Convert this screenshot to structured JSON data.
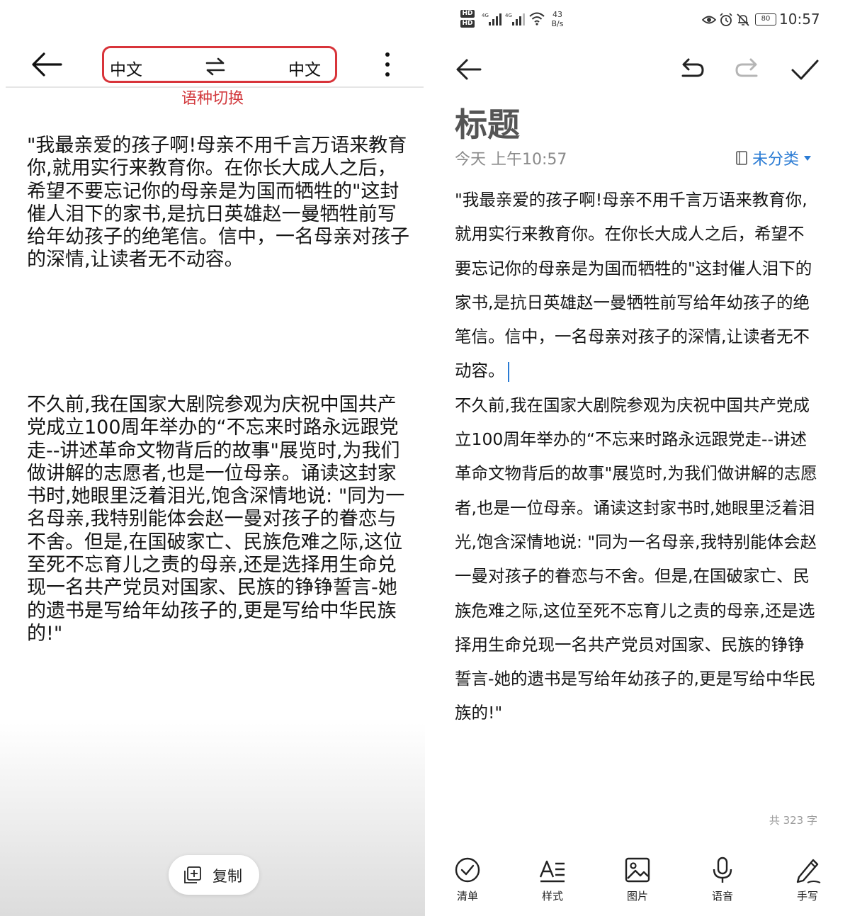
{
  "left": {
    "lang_source": "中文",
    "lang_target": "中文",
    "switch_caption": "语种切换",
    "paragraph_1": "\"我最亲爱的孩子啊!母亲不用千言万语来教育你,就用实行来教育你。在你长大成人之后，希望不要忘记你的母亲是为国而牺牲的\"这封催人泪下的家书,是抗日英雄赵一曼牺牲前写给年幼孩子的绝笔信。信中，一名母亲对孩子的深情,让读者无不动容。",
    "paragraph_2": "不久前,我在国家大剧院参观为庆祝中国共产党成立100周年举办的“不忘来时路永远跟党走--讲述革命文物背后的故事\"展览时,为我们做讲解的志愿者,也是一位母亲。诵读这封家书时,她眼里泛着泪光,饱含深情地说: \"同为一名母亲,我特别能体会赵一曼对孩子的眷恋与不舍。但是,在国破家亡、民族危难之际,这位至死不忘育儿之责的母亲,还是选择用生命兑现一名共产党员对国家、民族的铮铮誓言-她的遗书是写给年幼孩子的,更是写给中华民族的!\"",
    "copy_label": "复制"
  },
  "status_bar": {
    "badge_1": "HD",
    "badge_2": "HD",
    "speed_value": "43",
    "speed_unit": "B/s",
    "battery": "80",
    "time": "10:57"
  },
  "note": {
    "title": "标题",
    "date": "今天 上午10:57",
    "category": "未分类",
    "body_1": "\"我最亲爱的孩子啊!母亲不用千言万语来教育你,就用实行来教育你。在你长大成人之后，希望不要忘记你的母亲是为国而牺牲的\"这封催人泪下的家书,是抗日英雄赵一曼牺牲前写给年幼孩子的绝笔信。信中，一名母亲对孩子的深情,让读者无不动容。",
    "body_2": "不久前,我在国家大剧院参观为庆祝中国共产党成立100周年举办的“不忘来时路永远跟党走--讲述革命文物背后的故事\"展览时,为我们做讲解的志愿者,也是一位母亲。诵读这封家书时,她眼里泛着泪光,饱含深情地说: \"同为一名母亲,我特别能体会赵一曼对孩子的眷恋与不舍。但是,在国破家亡、民族危难之际,这位至死不忘育儿之责的母亲,还是选择用生命兑现一名共产党员对国家、民族的铮铮誓言-她的遗书是写给年幼孩子的,更是写给中华民族的!\"",
    "word_count": "共 323 字"
  },
  "bottom_bar": {
    "checklist": "清单",
    "style": "样式",
    "image": "图片",
    "voice": "语音",
    "handwriting": "手写"
  },
  "colors": {
    "highlight_red": "#d8343a",
    "accent_blue": "#2a7bd4"
  }
}
